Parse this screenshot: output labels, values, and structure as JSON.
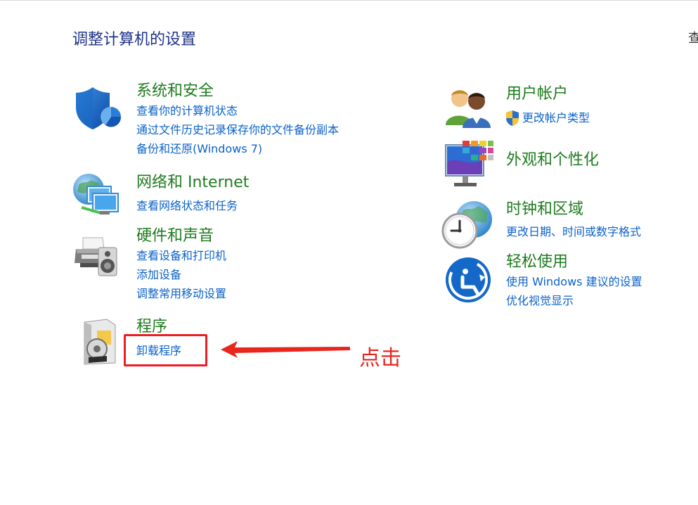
{
  "page": {
    "title": "调整计算机的设置",
    "edge_text": "查"
  },
  "categories_left": [
    {
      "title": "系统和安全",
      "icon": "shield-icon",
      "links": [
        "查看你的计算机状态",
        "通过文件历史记录保存你的文件备份副本",
        "备份和还原(Windows 7)"
      ]
    },
    {
      "title": "网络和 Internet",
      "icon": "network-icon",
      "links": [
        "查看网络状态和任务"
      ]
    },
    {
      "title": "硬件和声音",
      "icon": "printer-icon",
      "links": [
        "查看设备和打印机",
        "添加设备",
        "调整常用移动设置"
      ]
    },
    {
      "title": "程序",
      "icon": "programs-icon",
      "links": [
        "卸载程序"
      ]
    }
  ],
  "categories_right": [
    {
      "title": "用户帐户",
      "icon": "users-icon",
      "links": [
        "更改帐户类型"
      ]
    },
    {
      "title": "外观和个性化",
      "icon": "monitor-icon",
      "links": []
    },
    {
      "title": "时钟和区域",
      "icon": "clock-icon",
      "links": [
        "更改日期、时间或数字格式"
      ]
    },
    {
      "title": "轻松使用",
      "icon": "ease-of-access-icon",
      "links": [
        "使用 Windows 建议的设置",
        "优化视觉显示"
      ]
    }
  ],
  "annotation": {
    "text": "点击",
    "color": "#e8261e"
  },
  "colors": {
    "title_blue": "#1e3287",
    "category_green": "#1e7b1e",
    "link_blue": "#0b62c9"
  }
}
